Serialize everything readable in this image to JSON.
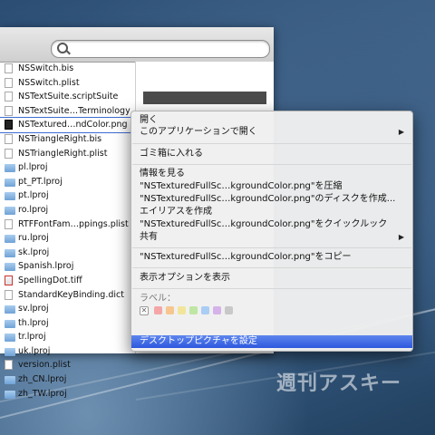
{
  "finder": {
    "files": [
      {
        "name": "NSSwitch.bis",
        "icon": "document-icon"
      },
      {
        "name": "NSSwitch.plist",
        "icon": "document-icon"
      },
      {
        "name": "NSTextSuite.scriptSuite",
        "icon": "document-icon"
      },
      {
        "name": "NSTextSuite…Terminology",
        "icon": "document-icon"
      },
      {
        "name": "NSTextured…ndColor.png",
        "icon": "png-icon",
        "selected": true
      },
      {
        "name": "NSTriangleRight.bis",
        "icon": "document-icon"
      },
      {
        "name": "NSTriangleRight.plist",
        "icon": "document-icon"
      },
      {
        "name": "pl.lproj",
        "icon": "folder-icon"
      },
      {
        "name": "pt_PT.lproj",
        "icon": "folder-icon"
      },
      {
        "name": "pt.lproj",
        "icon": "folder-icon"
      },
      {
        "name": "ro.lproj",
        "icon": "folder-icon"
      },
      {
        "name": "RTFFontFam…ppings.plist",
        "icon": "document-icon"
      },
      {
        "name": "ru.lproj",
        "icon": "folder-icon"
      },
      {
        "name": "sk.lproj",
        "icon": "folder-icon"
      },
      {
        "name": "Spanish.lproj",
        "icon": "folder-icon"
      },
      {
        "name": "SpellingDot.tiff",
        "icon": "tiff-icon"
      },
      {
        "name": "StandardKeyBinding.dict",
        "icon": "document-icon"
      },
      {
        "name": "sv.lproj",
        "icon": "folder-icon"
      },
      {
        "name": "th.lproj",
        "icon": "folder-icon"
      },
      {
        "name": "tr.lproj",
        "icon": "folder-icon"
      },
      {
        "name": "uk.lproj",
        "icon": "folder-icon"
      },
      {
        "name": "version.plist",
        "icon": "document-icon"
      },
      {
        "name": "zh_CN.lproj",
        "icon": "folder-icon"
      },
      {
        "name": "zh_TW.lproj",
        "icon": "folder-icon"
      }
    ]
  },
  "menu": {
    "open": "開く",
    "open_with": "このアプリケーションで開く",
    "trash": "ゴミ箱に入れる",
    "get_info": "情報を見る",
    "compress": "\"NSTexturedFullSc…kgroundColor.png\"を圧縮",
    "burn": "\"NSTexturedFullSc…kgroundColor.png\"のディスクを作成...",
    "alias": "エイリアスを作成",
    "quicklook": "\"NSTexturedFullSc…kgroundColor.png\"をクイックルック",
    "share": "共有",
    "copy": "\"NSTexturedFullSc…kgroundColor.png\"をコピー",
    "view_options": "表示オプションを表示",
    "label": "ラベル：",
    "desktop_picture": "デスクトップピクチャを設定",
    "label_colors": [
      "#f4a6a6",
      "#f7c68f",
      "#f2e59a",
      "#bfe6a3",
      "#a9cdf3",
      "#d5b2ea",
      "#c8c8c8"
    ]
  },
  "watermark": "週刊アスキー"
}
